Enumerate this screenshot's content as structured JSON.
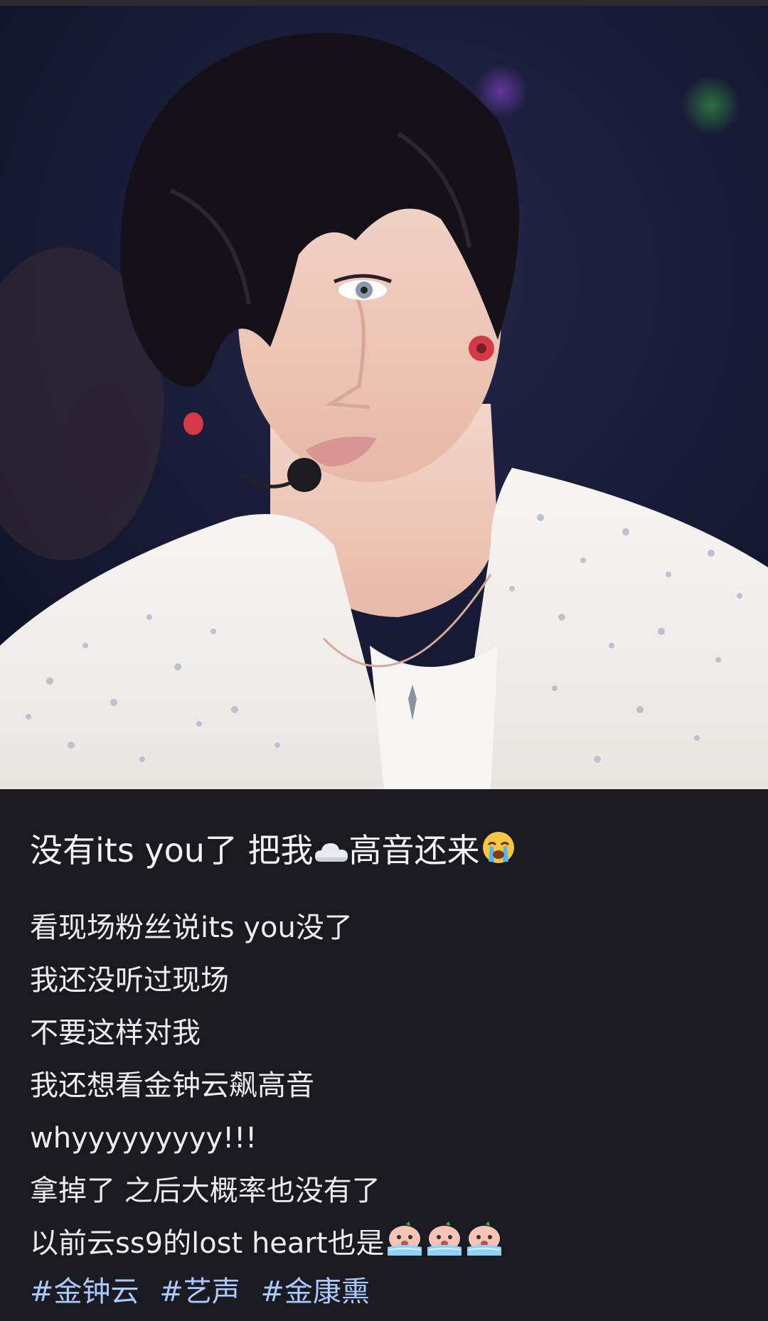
{
  "post": {
    "title_text": "没有its you了 把我",
    "title_after_cloud": "高音还来",
    "title_icons": [
      "cloud-icon",
      "crying-face-icon"
    ],
    "body_lines": [
      "看现场粉丝说its you没了",
      "我还没听过现场",
      "不要这样对我",
      "我还想看金钟云飙高音",
      "whyyyyyyyyy!!!",
      "拿掉了 之后大概率也没有了",
      "以前云ss9的lost heart也是"
    ],
    "body_last_line_icons": [
      "crying-peach-sticker-icon",
      "crying-peach-sticker-icon",
      "crying-peach-sticker-icon"
    ],
    "hashtags": [
      "#金钟云",
      "#艺声",
      "#金康熏"
    ]
  },
  "photo": {
    "semantic": "concert-performer-photo",
    "colors": {
      "background": "#171a33",
      "jacket": "#f3f1ee",
      "hair": "#141218",
      "skin": "#f0cdbf"
    }
  },
  "theme": {
    "page_background": "#1b1a20",
    "text": "#f2f2f4",
    "hashtag": "#a9c9ff"
  }
}
